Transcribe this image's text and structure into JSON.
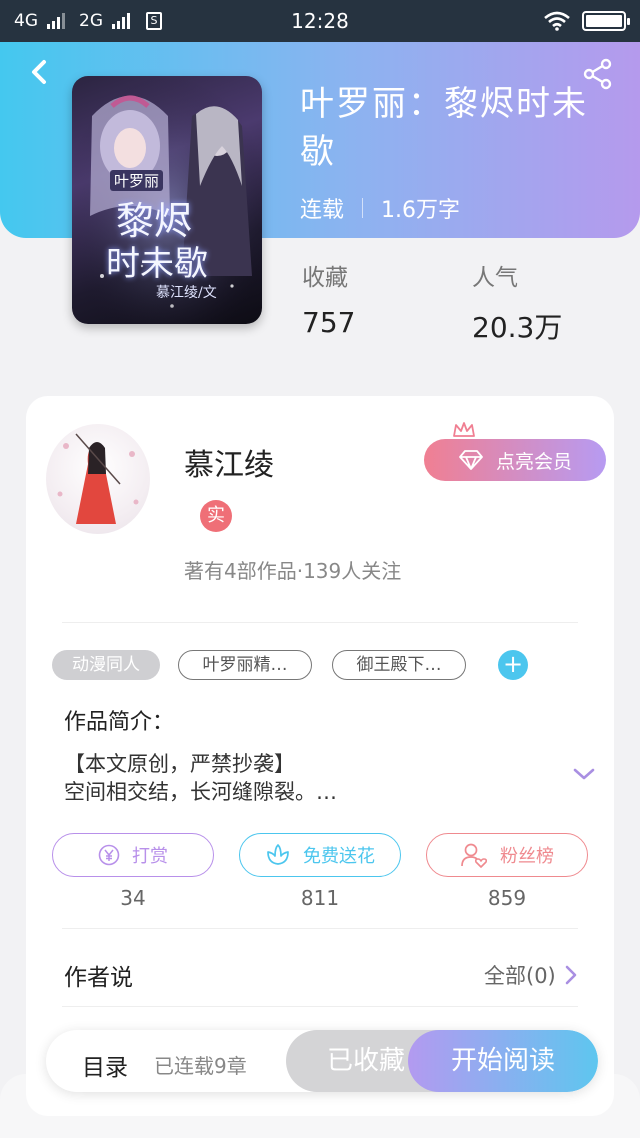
{
  "status_bar": {
    "network1": "4G",
    "network2": "2G",
    "sim_label": "S",
    "time": "12:28",
    "battery_level": 1.0
  },
  "book": {
    "title": "叶罗丽：黎烬时未歇",
    "status": "连载",
    "word_count": "1.6万字",
    "cover_text_top": "叶罗丽",
    "cover_text_main1": "黎烬",
    "cover_text_main2": "时未歇",
    "cover_text_author": "慕江绫/文",
    "favorites_label": "收藏",
    "favorites_value": "757",
    "popularity_label": "人气",
    "popularity_value": "20.3万"
  },
  "author": {
    "name": "慕江绫",
    "badge": "实",
    "stats": "著有4部作品·139人关注",
    "vip_button": "点亮会员"
  },
  "tags": {
    "genre": "动漫同人",
    "tag1": "叶罗丽精…",
    "tag2": "御王殿下…",
    "add": "+"
  },
  "intro": {
    "label": "作品简介：",
    "line1": "【本文原创，严禁抄袭】",
    "line2": "空间相交结，长河缝隙裂。…"
  },
  "actions": {
    "reward_label": "打赏",
    "reward_count": "34",
    "flower_label": "免费送花",
    "flower_count": "811",
    "fans_label": "粉丝榜",
    "fans_count": "859"
  },
  "author_say": {
    "label": "作者说",
    "all": "全部(0)"
  },
  "bottom": {
    "toc": "目录",
    "toc_status": "已连载9章",
    "favorited": "已收藏",
    "start_reading": "开始阅读"
  },
  "colors": {
    "header_start": "#44c8ef",
    "header_end": "#b59aed",
    "reward": "#b890ea",
    "flower": "#4cc6ee",
    "fans": "#ef8a8f"
  },
  "icons": [
    "back-icon",
    "share-icon",
    "crown-icon",
    "diamond-icon",
    "plus-icon",
    "chevron-down-icon",
    "yuan-icon",
    "flower-icon",
    "fans-icon",
    "chevron-right-icon"
  ]
}
